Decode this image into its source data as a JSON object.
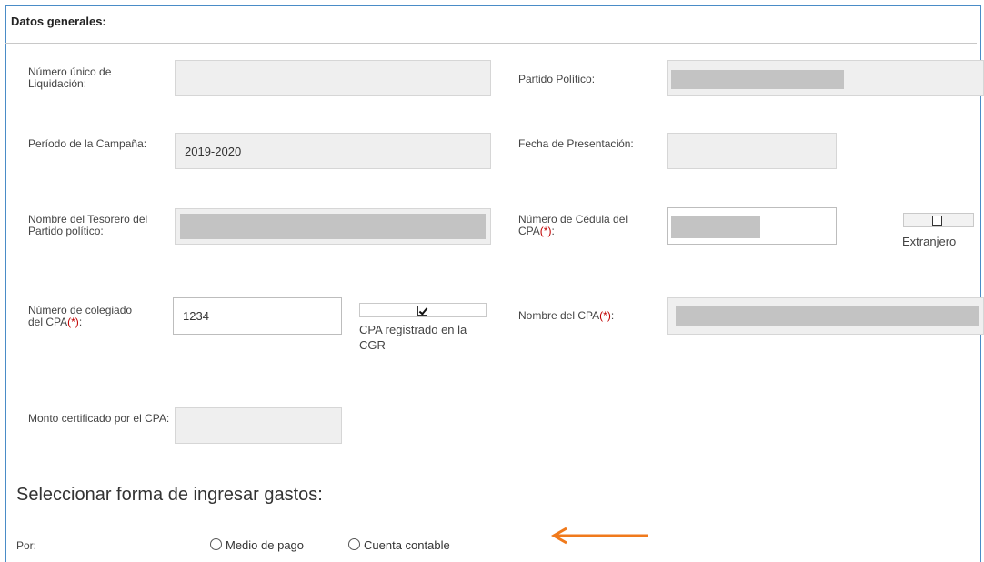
{
  "panel": {
    "title": "Datos generales:"
  },
  "fields": {
    "liquidacion": {
      "label": "Número único de Liquidación:",
      "value": ""
    },
    "partido": {
      "label": "Partido Político:",
      "value": ""
    },
    "periodo": {
      "label": "Período de la Campaña:",
      "value": "2019-2020"
    },
    "fecha": {
      "label": "Fecha de Presentación:",
      "value": ""
    },
    "tesorero": {
      "label": "Nombre del Tesorero del Partido político:",
      "value": ""
    },
    "cedula": {
      "label_a": "Número de Cédula del",
      "label_b": "CPA",
      "req": "(*)",
      "colon": ":",
      "value": ""
    },
    "colegiado": {
      "label_a": "Número de colegiado",
      "label_b": "del CPA",
      "req": "(*)",
      "colon": ":",
      "value": "1234"
    },
    "nombre_cpa": {
      "label": "Nombre del CPA",
      "req": "(*)",
      "colon": ":",
      "value": ""
    },
    "monto": {
      "label": "Monto certificado por el CPA:",
      "value": ""
    }
  },
  "checkboxes": {
    "extranjero": {
      "label": "Extranjero",
      "checked": false
    },
    "cpa_cgr": {
      "label": "CPA registrado en la CGR",
      "checked": true
    }
  },
  "gastos": {
    "heading": "Seleccionar forma de ingresar gastos:",
    "por_label": "Por:",
    "options": [
      "Medio de pago",
      "Cuenta contable"
    ]
  },
  "colors": {
    "accent_border": "#4a8cc7",
    "required": "#c00000",
    "arrow": "#f07a1c"
  }
}
